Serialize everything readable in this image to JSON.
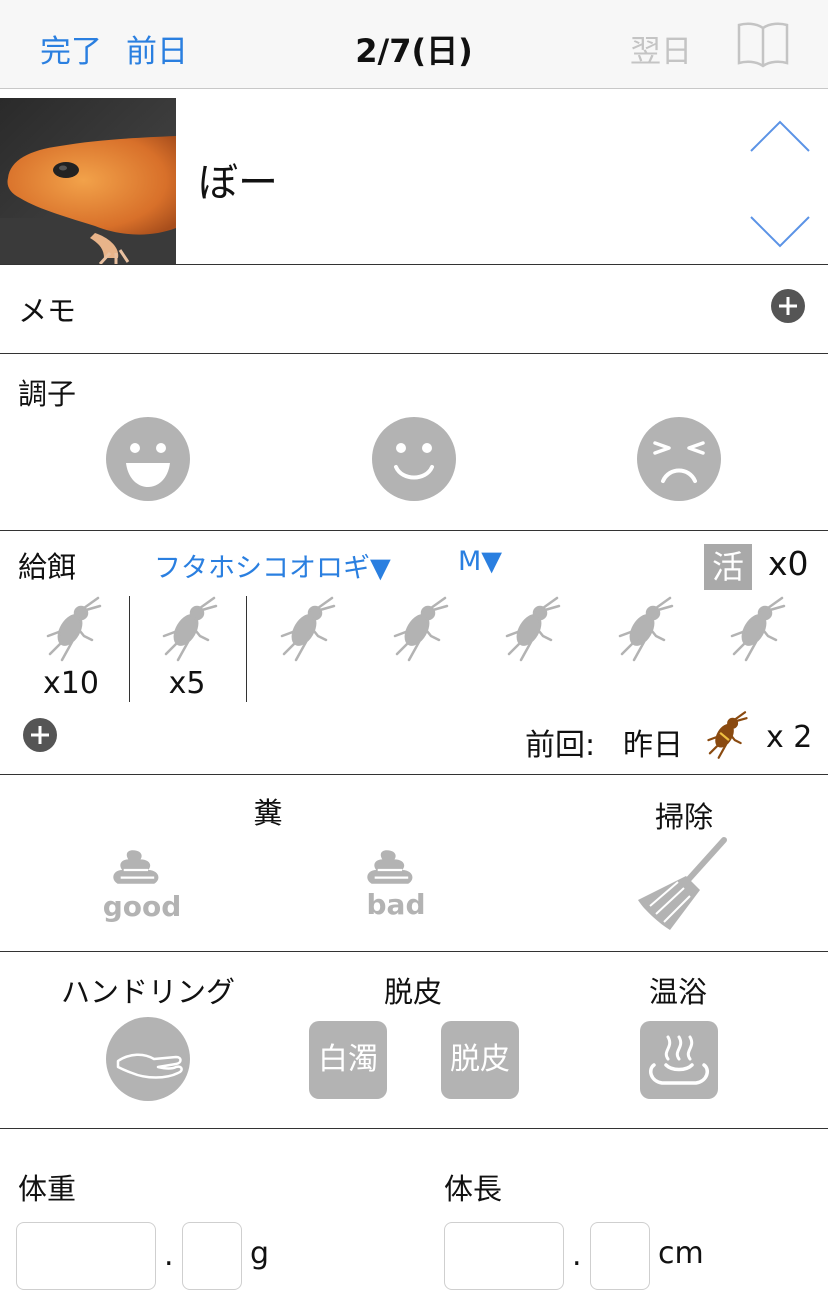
{
  "nav": {
    "done": "完了",
    "prev_day": "前日",
    "title": "2/7(日)",
    "next_day": "翌日"
  },
  "pet": {
    "name": "ぼー"
  },
  "memo": {
    "label": "メモ"
  },
  "condition": {
    "label": "調子"
  },
  "feeding": {
    "label": "給餌",
    "food_type": "フタホシコオロギ▼",
    "size": "M▼",
    "live_badge": "活",
    "live_count": "x0",
    "counts": [
      "x10",
      "x5"
    ],
    "previous_label": "前回:",
    "previous_value": "昨日",
    "previous_count": "x 2"
  },
  "droppings": {
    "label": "糞",
    "good": "good",
    "bad": "bad",
    "cleaning_label": "掃除"
  },
  "activities": {
    "handling_label": "ハンドリング",
    "shedding_label": "脱皮",
    "cloudy": "白濁",
    "shed": "脱皮",
    "bath_label": "温浴"
  },
  "measure": {
    "weight_label": "体重",
    "weight_unit": "g",
    "length_label": "体長",
    "length_unit": "cm",
    "decimal": "."
  },
  "colors": {
    "accent": "#2a7fe0",
    "icon_gray": "#b3b3b3",
    "cricket_brown": "#8a4a10"
  }
}
